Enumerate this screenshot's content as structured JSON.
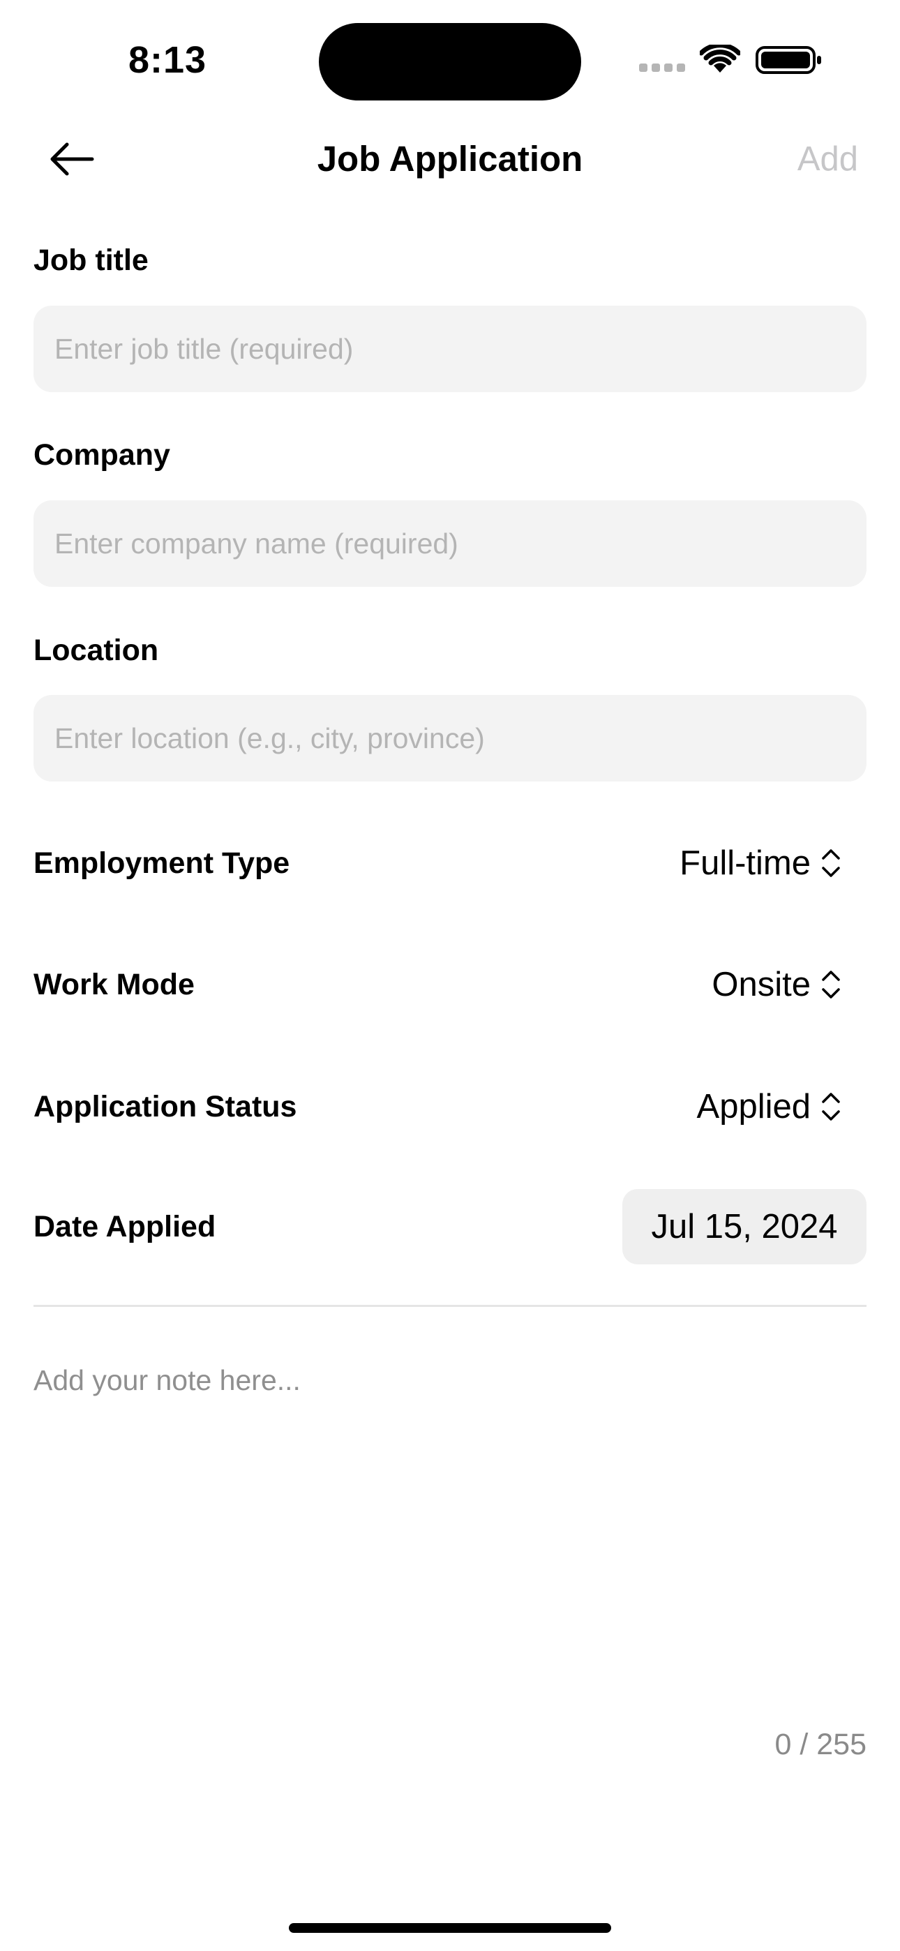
{
  "status_bar": {
    "time": "8:13"
  },
  "nav": {
    "title": "Job Application",
    "add_label": "Add"
  },
  "form": {
    "job_title": {
      "label": "Job title",
      "placeholder": "Enter job title (required)",
      "value": ""
    },
    "company": {
      "label": "Company",
      "placeholder": "Enter company name (required)",
      "value": ""
    },
    "location": {
      "label": "Location",
      "placeholder": "Enter location (e.g., city, province)",
      "value": ""
    },
    "employment_type": {
      "label": "Employment Type",
      "value": "Full-time"
    },
    "work_mode": {
      "label": "Work Mode",
      "value": "Onsite"
    },
    "application_status": {
      "label": "Application Status",
      "value": "Applied"
    },
    "date_applied": {
      "label": "Date Applied",
      "value": "Jul 15, 2024"
    },
    "note": {
      "placeholder": "Add your note here...",
      "value": "",
      "char_count": "0 / 255"
    }
  },
  "icons": {
    "back": "arrow-left-icon",
    "picker": "chevron-up-down-icon",
    "wifi": "wifi-icon",
    "battery": "battery-icon",
    "signal": "cellular-signal-icon"
  },
  "colors": {
    "field_background": "#f3f3f3",
    "placeholder": "#b4b4b4",
    "disabled_action": "#c6c6c8",
    "date_chip_background": "#efefef"
  }
}
